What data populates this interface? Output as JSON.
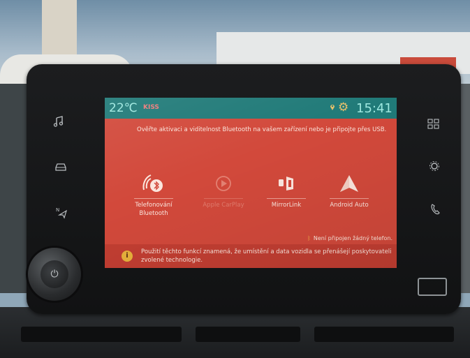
{
  "status": {
    "temperature": "22℃",
    "station": "KISS",
    "time": "15:41"
  },
  "message": "Ověřte aktivaci a viditelnost Bluetooth na vašem zařízení nebo je připojte přes USB.",
  "tiles": [
    {
      "label": "Telefonování Bluetooth",
      "icon": "bluetooth-phone-icon",
      "enabled": true
    },
    {
      "label": "Apple CarPlay",
      "icon": "carplay-icon",
      "enabled": false
    },
    {
      "label": "MirrorLink",
      "icon": "mirrorlink-icon",
      "enabled": true
    },
    {
      "label": "Android Auto",
      "icon": "android-auto-icon",
      "enabled": true
    }
  ],
  "no_phone": "Není připojen žádný telefon.",
  "footer": "Použití těchto funkcí znamená, že umístění a data vozidla se přenášejí poskytovateli zvolené technologie.",
  "colors": {
    "screen_bg": "#d2493b",
    "statusbar_bg": "#207a78",
    "accent": "#e7c06a"
  }
}
